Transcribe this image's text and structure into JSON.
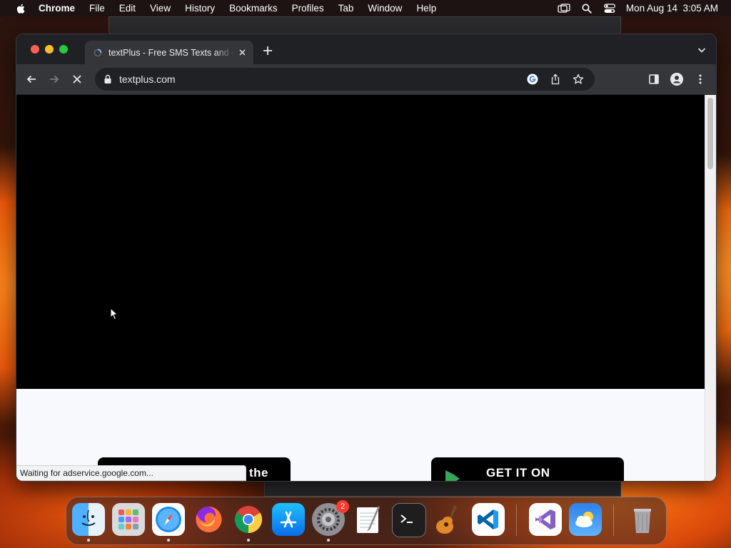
{
  "menubar": {
    "app_name": "Chrome",
    "items": [
      "File",
      "Edit",
      "View",
      "History",
      "Bookmarks",
      "Profiles",
      "Tab",
      "Window",
      "Help"
    ],
    "clock": "Mon Aug 14  3:05 AM"
  },
  "browser": {
    "tab": {
      "title": "textPlus - Free SMS Texts and Calls"
    },
    "address": {
      "url": "textplus.com"
    },
    "status": "Waiting for adservice.google.com..."
  },
  "page": {
    "apple_button_text": "the",
    "google_button_text": "GET IT ON"
  },
  "dock": {
    "apps": [
      "Finder",
      "Launchpad",
      "Safari",
      "Firefox",
      "Google Chrome",
      "App Store",
      "System Settings",
      "TextEdit",
      "Terminal",
      "GarageBand",
      "Visual Studio Code",
      "Visual Studio",
      "Weather",
      "Trash"
    ],
    "settings_badge": "2"
  },
  "colors": {
    "accent": "#8ab4f8",
    "window_bg": "#202124",
    "toolbar_bg": "#35363a",
    "badge": "#ff3b30"
  }
}
